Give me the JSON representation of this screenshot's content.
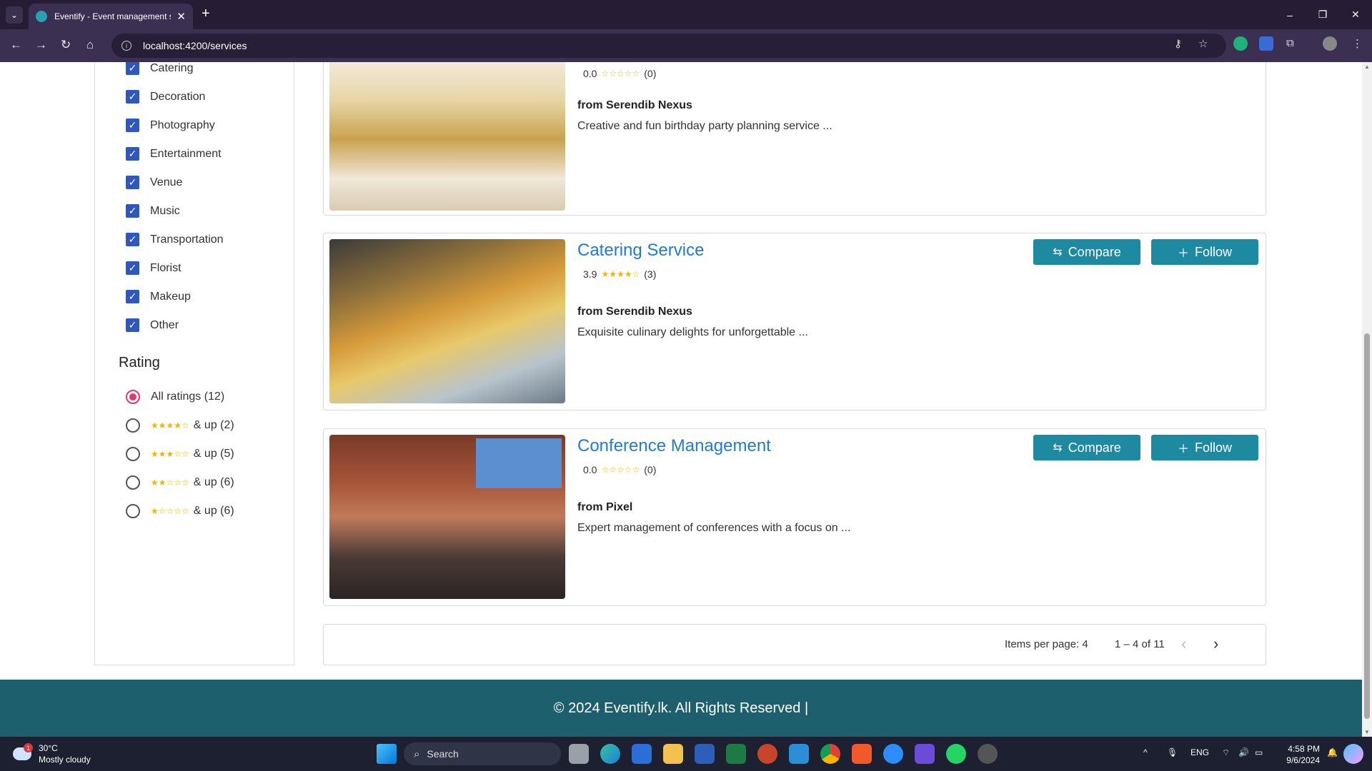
{
  "browser": {
    "tab_title": "Eventify - Event management sy",
    "url": "localhost:4200/services",
    "window_controls": [
      "–",
      "❐",
      "✕"
    ]
  },
  "sidebar": {
    "categories": [
      "Catering",
      "Decoration",
      "Photography",
      "Entertainment",
      "Venue",
      "Music",
      "Transportation",
      "Florist",
      "Makeup",
      "Other"
    ],
    "rating_heading": "Rating",
    "rating_options": [
      {
        "label": "All ratings (12)",
        "stars": "",
        "selected": true
      },
      {
        "label": "& up (2)",
        "stars": "★★★★☆",
        "selected": false
      },
      {
        "label": "& up (5)",
        "stars": "★★★☆☆",
        "selected": false
      },
      {
        "label": "& up (6)",
        "stars": "★★☆☆☆",
        "selected": false
      },
      {
        "label": "& up (6)",
        "stars": "★☆☆☆☆",
        "selected": false
      }
    ]
  },
  "services": [
    {
      "title": "",
      "rating": "0.0",
      "stars": "☆☆☆☆☆",
      "count": "(0)",
      "from": "from Serendib Nexus",
      "desc": "Creative and fun birthday party planning service ..."
    },
    {
      "title": "Catering Service",
      "rating": "3.9",
      "stars": "★★★★☆",
      "count": "(3)",
      "from": "from Serendib Nexus",
      "desc": "Exquisite culinary delights for unforgettable ..."
    },
    {
      "title": "Conference Management",
      "rating": "0.0",
      "stars": "☆☆☆☆☆",
      "count": "(0)",
      "from": "from Pixel",
      "desc": "Expert management of conferences with a focus on ..."
    }
  ],
  "buttons": {
    "compare": "Compare",
    "follow": "Follow"
  },
  "paginator": {
    "items_per_page": "Items per page: 4",
    "range": "1 – 4 of 11"
  },
  "footer": {
    "text": "© 2024 Eventify.lk. All Rights Reserved |"
  },
  "taskbar": {
    "temp": "30°C",
    "weather": "Mostly cloudy",
    "weather_badge": "1",
    "search": "Search",
    "lang": "ENG",
    "time": "4:58 PM",
    "date": "9/6/2024"
  },
  "colors": {
    "accent": "#1e8aa2",
    "title": "#1f7bd3",
    "footer": "#1e5f6d",
    "checkbox": "#3057b9",
    "radio": "#e53571"
  }
}
